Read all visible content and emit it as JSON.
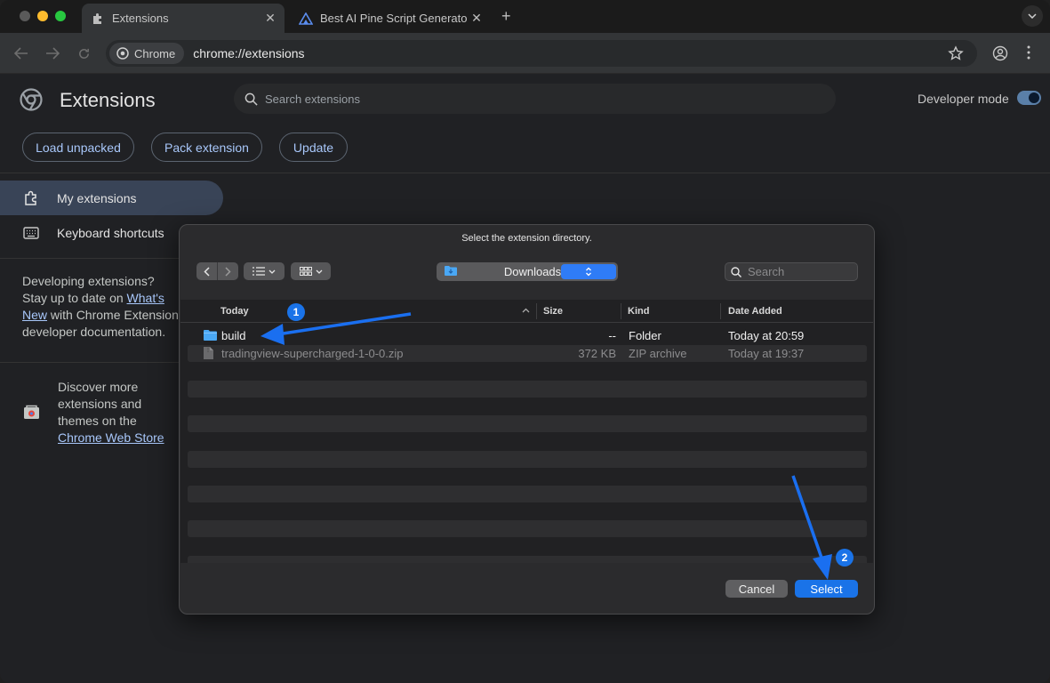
{
  "browser": {
    "tabs": [
      {
        "title": "Extensions",
        "icon": "puzzle-icon",
        "active": true
      },
      {
        "title": "Best AI Pine Script Generator",
        "icon": "pine-logo-icon",
        "active": false
      }
    ],
    "chip_label": "Chrome",
    "url": "chrome://extensions"
  },
  "extensions_page": {
    "title": "Extensions",
    "search_placeholder": "Search extensions",
    "developer_mode_label": "Developer mode",
    "developer_mode_on": true,
    "actions": {
      "load_unpacked": "Load unpacked",
      "pack_extension": "Pack extension",
      "update": "Update"
    },
    "sidebar": {
      "items": [
        {
          "label": "My extensions",
          "icon": "extension-icon"
        },
        {
          "label": "Keyboard shortcuts",
          "icon": "keyboard-icon"
        }
      ],
      "dev_text_1": "Developing extensions? Stay up to date on ",
      "dev_link": "What's New",
      "dev_text_2": " with Chrome Extension developer documentation.",
      "store_text_1": "Discover more extensions and themes on the ",
      "store_link": "Chrome Web Store"
    }
  },
  "dialog": {
    "title": "Select the extension directory.",
    "location": "Downloads",
    "search_placeholder": "Search",
    "columns": {
      "name": "Today",
      "size": "Size",
      "kind": "Kind",
      "date": "Date Added"
    },
    "files": [
      {
        "name": "build",
        "size": "--",
        "kind": "Folder",
        "date": "Today at 20:59",
        "icon": "folder-icon"
      },
      {
        "name": "tradingview-supercharged-1-0-0.zip",
        "size": "372 KB",
        "kind": "ZIP archive",
        "date": "Today at 19:37",
        "icon": "file-icon"
      }
    ],
    "cancel_label": "Cancel",
    "select_label": "Select"
  },
  "annotations": {
    "step1": "1",
    "step2": "2",
    "arrow_color": "#1a6ff0"
  }
}
